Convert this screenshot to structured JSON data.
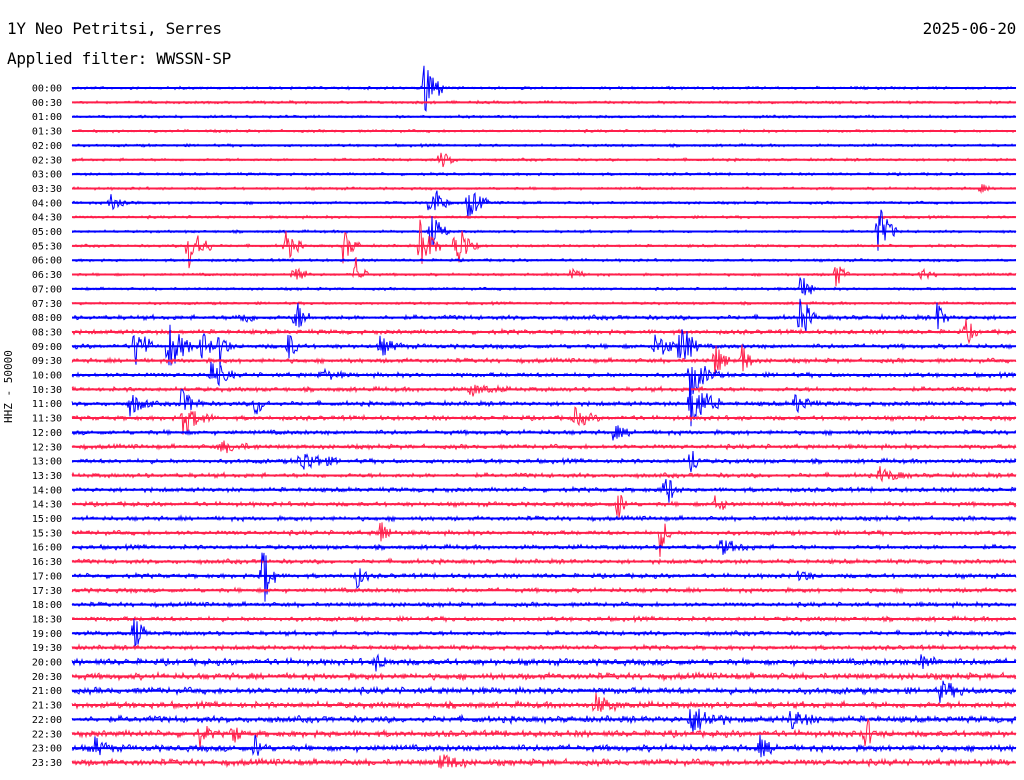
{
  "header": {
    "station": "1Y Neo Petritsi, Serres",
    "date": "2025-06-20",
    "filter": "Applied filter: WWSSN-SP"
  },
  "channel_label": "HHZ - 50000",
  "colors": {
    "blue": "#0000ff",
    "red": "#ff1f4b"
  },
  "rows": [
    {
      "time": "00:00",
      "color": "blue"
    },
    {
      "time": "00:30",
      "color": "red"
    },
    {
      "time": "01:00",
      "color": "blue"
    },
    {
      "time": "01:30",
      "color": "red"
    },
    {
      "time": "02:00",
      "color": "blue"
    },
    {
      "time": "02:30",
      "color": "red"
    },
    {
      "time": "03:00",
      "color": "blue"
    },
    {
      "time": "03:30",
      "color": "red"
    },
    {
      "time": "04:00",
      "color": "blue"
    },
    {
      "time": "04:30",
      "color": "red"
    },
    {
      "time": "05:00",
      "color": "blue"
    },
    {
      "time": "05:30",
      "color": "red"
    },
    {
      "time": "06:00",
      "color": "blue"
    },
    {
      "time": "06:30",
      "color": "red"
    },
    {
      "time": "07:00",
      "color": "blue"
    },
    {
      "time": "07:30",
      "color": "red"
    },
    {
      "time": "08:00",
      "color": "blue"
    },
    {
      "time": "08:30",
      "color": "red"
    },
    {
      "time": "09:00",
      "color": "blue"
    },
    {
      "time": "09:30",
      "color": "red"
    },
    {
      "time": "10:00",
      "color": "blue"
    },
    {
      "time": "10:30",
      "color": "red"
    },
    {
      "time": "11:00",
      "color": "blue"
    },
    {
      "time": "11:30",
      "color": "red"
    },
    {
      "time": "12:00",
      "color": "blue"
    },
    {
      "time": "12:30",
      "color": "red"
    },
    {
      "time": "13:00",
      "color": "blue"
    },
    {
      "time": "13:30",
      "color": "red"
    },
    {
      "time": "14:00",
      "color": "blue"
    },
    {
      "time": "14:30",
      "color": "red"
    },
    {
      "time": "15:00",
      "color": "blue"
    },
    {
      "time": "15:30",
      "color": "red"
    },
    {
      "time": "16:00",
      "color": "blue"
    },
    {
      "time": "16:30",
      "color": "red"
    },
    {
      "time": "17:00",
      "color": "blue"
    },
    {
      "time": "17:30",
      "color": "red"
    },
    {
      "time": "18:00",
      "color": "blue"
    },
    {
      "time": "18:30",
      "color": "red"
    },
    {
      "time": "19:00",
      "color": "blue"
    },
    {
      "time": "19:30",
      "color": "red"
    },
    {
      "time": "20:00",
      "color": "blue"
    },
    {
      "time": "20:30",
      "color": "red"
    },
    {
      "time": "21:00",
      "color": "blue"
    },
    {
      "time": "21:30",
      "color": "red"
    },
    {
      "time": "22:00",
      "color": "blue"
    },
    {
      "time": "22:30",
      "color": "red"
    },
    {
      "time": "23:00",
      "color": "blue"
    },
    {
      "time": "23:30",
      "color": "red"
    }
  ]
}
